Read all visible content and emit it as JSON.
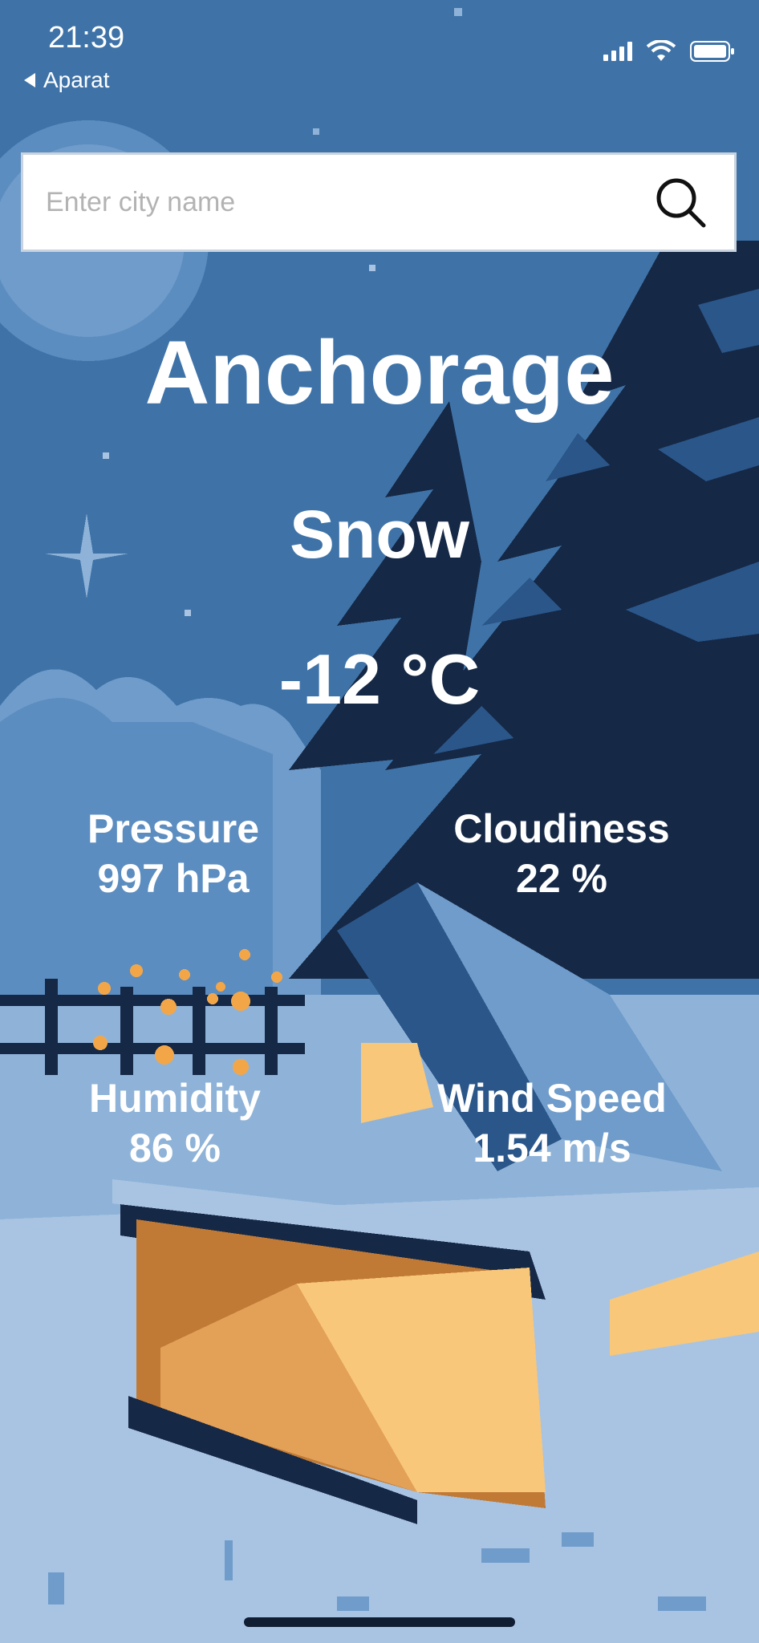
{
  "status_bar": {
    "time": "21:39",
    "back_label": "Aparat",
    "icons": [
      "signal-icon",
      "wifi-icon",
      "battery-icon"
    ]
  },
  "search": {
    "placeholder": "Enter city name",
    "value": "",
    "icon": "search-icon"
  },
  "weather": {
    "city": "Anchorage",
    "condition": "Snow",
    "temperature": "-12 °C"
  },
  "stats": {
    "pressure": {
      "label": "Pressure",
      "value": "997 hPa"
    },
    "cloudiness": {
      "label": "Cloudiness",
      "value": "22 %"
    },
    "humidity": {
      "label": "Humidity",
      "value": "86 %"
    },
    "wind_speed": {
      "label": "Wind Speed",
      "value": "1.54 m/s"
    }
  },
  "colors": {
    "sky": "#3f73a8",
    "tree_dark": "#152846",
    "tree_mid": "#2a5689",
    "snow": "#8fb3d8",
    "snow_light": "#a9c4e2",
    "cabin_light": "#f8c77a",
    "cabin_dark": "#c07a36"
  }
}
